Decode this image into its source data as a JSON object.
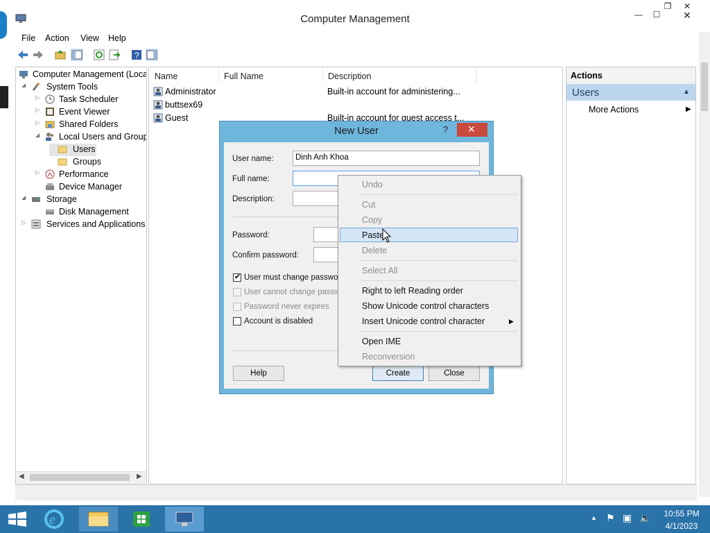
{
  "window": {
    "title": "Computer Management"
  },
  "menubar": [
    "File",
    "Action",
    "View",
    "Help"
  ],
  "tree": {
    "items": [
      {
        "label": "Computer Management (Local",
        "icon": "computer-management-icon"
      },
      {
        "label": "System Tools",
        "icon": "tools-icon"
      },
      {
        "label": "Task Scheduler",
        "icon": "clock-icon"
      },
      {
        "label": "Event Viewer",
        "icon": "event-viewer-icon"
      },
      {
        "label": "Shared Folders",
        "icon": "shared-folder-icon"
      },
      {
        "label": "Local Users and Groups",
        "icon": "users-icon"
      },
      {
        "label": "Users",
        "icon": "folder-icon"
      },
      {
        "label": "Groups",
        "icon": "folder-icon"
      },
      {
        "label": "Performance",
        "icon": "performance-icon"
      },
      {
        "label": "Device Manager",
        "icon": "device-manager-icon"
      },
      {
        "label": "Storage",
        "icon": "storage-icon"
      },
      {
        "label": "Disk Management",
        "icon": "disk-icon"
      },
      {
        "label": "Services and Applications",
        "icon": "services-icon"
      }
    ]
  },
  "list": {
    "columns": [
      "Name",
      "Full Name",
      "Description"
    ],
    "rows": [
      {
        "name": "Administrator",
        "full_name": "",
        "description": "Built-in account for administering..."
      },
      {
        "name": "buttsex69",
        "full_name": "",
        "description": ""
      },
      {
        "name": "Guest",
        "full_name": "",
        "description": "Built-in account for guest access t..."
      }
    ]
  },
  "actions": {
    "header": "Actions",
    "section": "Users",
    "more": "More Actions"
  },
  "dialog": {
    "title": "New User",
    "help_glyph": "?",
    "labels": {
      "username": "User name:",
      "fullname": "Full name:",
      "description": "Description:",
      "password": "Password:",
      "confirm": "Confirm password:"
    },
    "username_value": "Dinh Anh Khoa",
    "checkboxes": [
      {
        "label": "User must change password",
        "checked": true,
        "enabled": true
      },
      {
        "label": "User cannot change passwo",
        "checked": false,
        "enabled": false
      },
      {
        "label": "Password never expires",
        "checked": false,
        "enabled": false
      },
      {
        "label": "Account is disabled",
        "checked": false,
        "enabled": true
      }
    ],
    "buttons": {
      "help": "Help",
      "create": "Create",
      "close": "Close"
    }
  },
  "context_menu": {
    "items": [
      {
        "label": "Undo",
        "enabled": false
      },
      {
        "label": "Cut",
        "enabled": false
      },
      {
        "label": "Copy",
        "enabled": false
      },
      {
        "label": "Paste",
        "enabled": true,
        "highlighted": true
      },
      {
        "label": "Delete",
        "enabled": false
      },
      {
        "label": "Select All",
        "enabled": false
      },
      {
        "label": "Right to left Reading order",
        "enabled": true
      },
      {
        "label": "Show Unicode control characters",
        "enabled": true
      },
      {
        "label": "Insert Unicode control character",
        "enabled": true,
        "submenu": true
      },
      {
        "label": "Open IME",
        "enabled": true
      },
      {
        "label": "Reconversion",
        "enabled": false
      }
    ]
  },
  "taskbar": {
    "time": "10:55 PM",
    "date": "4/1/2023"
  },
  "colors": {
    "accent": "#2a73a8",
    "dialog_frame": "#6fb6dd",
    "highlight": "#d4e5f6",
    "close_red": "#c94a3d"
  }
}
